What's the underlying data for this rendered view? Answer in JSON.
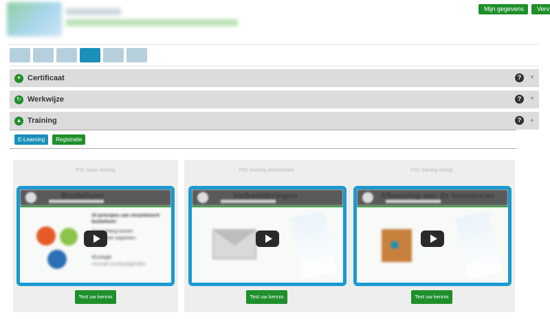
{
  "header": {
    "buttons": {
      "mijn_gegevens": "Mijn gegevens",
      "verv": "Verv"
    }
  },
  "scheme_tabs": {
    "active_index": 3
  },
  "accordion": {
    "certificaat": "Certificaat",
    "werkwijze": "Werkwijze",
    "training": "Training",
    "help_glyph": "?"
  },
  "training_tabs": {
    "elearning": "E-Learning",
    "registratie": "Registratie"
  },
  "videos": [
    {
      "label": "FSC basis training",
      "title": "Bosbeheer",
      "button": "Test uw kennis"
    },
    {
      "label": "FSC training administratie",
      "title": "Verbeelderingen",
      "button": "Test uw kennis"
    },
    {
      "label": "FSC training inkoop",
      "title": "Aflevering van de leverancier",
      "button": "Test uw kennis"
    }
  ],
  "video1_slide": {
    "heading": "10 principes van verantwoord bosbeheer:",
    "line1": "Samenhang tussen",
    "line2": "bosbeheer aspecten:",
    "line3": "•Ecologie",
    "line4": "•Sociale omstandigheden"
  },
  "colors": {
    "brand_green": "#1e8f2a",
    "brand_blue": "#1a8fb8",
    "accordion_bg": "#dcdcdc"
  }
}
